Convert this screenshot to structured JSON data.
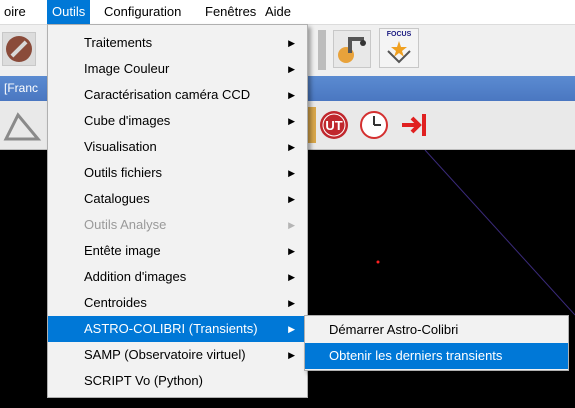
{
  "menubar": {
    "items": [
      {
        "label": "oire"
      },
      {
        "label": "Outils"
      },
      {
        "label": "Configuration"
      },
      {
        "label": "Fenêtres"
      },
      {
        "label": "Aide"
      }
    ]
  },
  "window": {
    "title_fragment": "[Franc"
  },
  "menu": {
    "items": [
      {
        "label": "Traitements",
        "submenu": true,
        "enabled": true
      },
      {
        "label": "Image Couleur",
        "submenu": true,
        "enabled": true
      },
      {
        "label": "Caractérisation caméra CCD",
        "submenu": true,
        "enabled": true
      },
      {
        "label": "Cube d'images",
        "submenu": true,
        "enabled": true
      },
      {
        "label": "Visualisation",
        "submenu": true,
        "enabled": true
      },
      {
        "label": "Outils fichiers",
        "submenu": true,
        "enabled": true
      },
      {
        "label": "Catalogues",
        "submenu": true,
        "enabled": true
      },
      {
        "label": "Outils Analyse",
        "submenu": true,
        "enabled": false
      },
      {
        "label": "Entête image",
        "submenu": true,
        "enabled": true
      },
      {
        "label": "Addition d'images",
        "submenu": true,
        "enabled": true
      },
      {
        "label": "Centroides",
        "submenu": true,
        "enabled": true
      },
      {
        "label": "ASTRO-COLIBRI (Transients)",
        "submenu": true,
        "enabled": true,
        "highlighted": true
      },
      {
        "label": "SAMP (Observatoire virtuel)",
        "submenu": true,
        "enabled": true
      },
      {
        "label": "SCRIPT Vo (Python)",
        "submenu": false,
        "enabled": true
      }
    ],
    "submenu_arrow": "▶"
  },
  "submenu": {
    "items": [
      {
        "label": "Démarrer Astro-Colibri"
      },
      {
        "label": "Obtenir les derniers transients",
        "highlighted": true
      }
    ]
  },
  "toolbar_icons": [
    "wrench-icon",
    "robot-arm-icon",
    "focus-star-icon",
    "ut-globe-icon",
    "clock-icon",
    "arrow-to-line-icon",
    "triangle-tool-icon"
  ],
  "colors": {
    "highlight": "#0078d7",
    "menu_bg": "#f2f2f2",
    "title_strip": "#4a77c1",
    "canvas": "#000000",
    "ut_icon": "#c0272d",
    "arrow_icon": "#e02020"
  },
  "toolbar": {
    "focus_label": "FOCUS"
  },
  "ut_icon": {
    "label": "UT"
  }
}
